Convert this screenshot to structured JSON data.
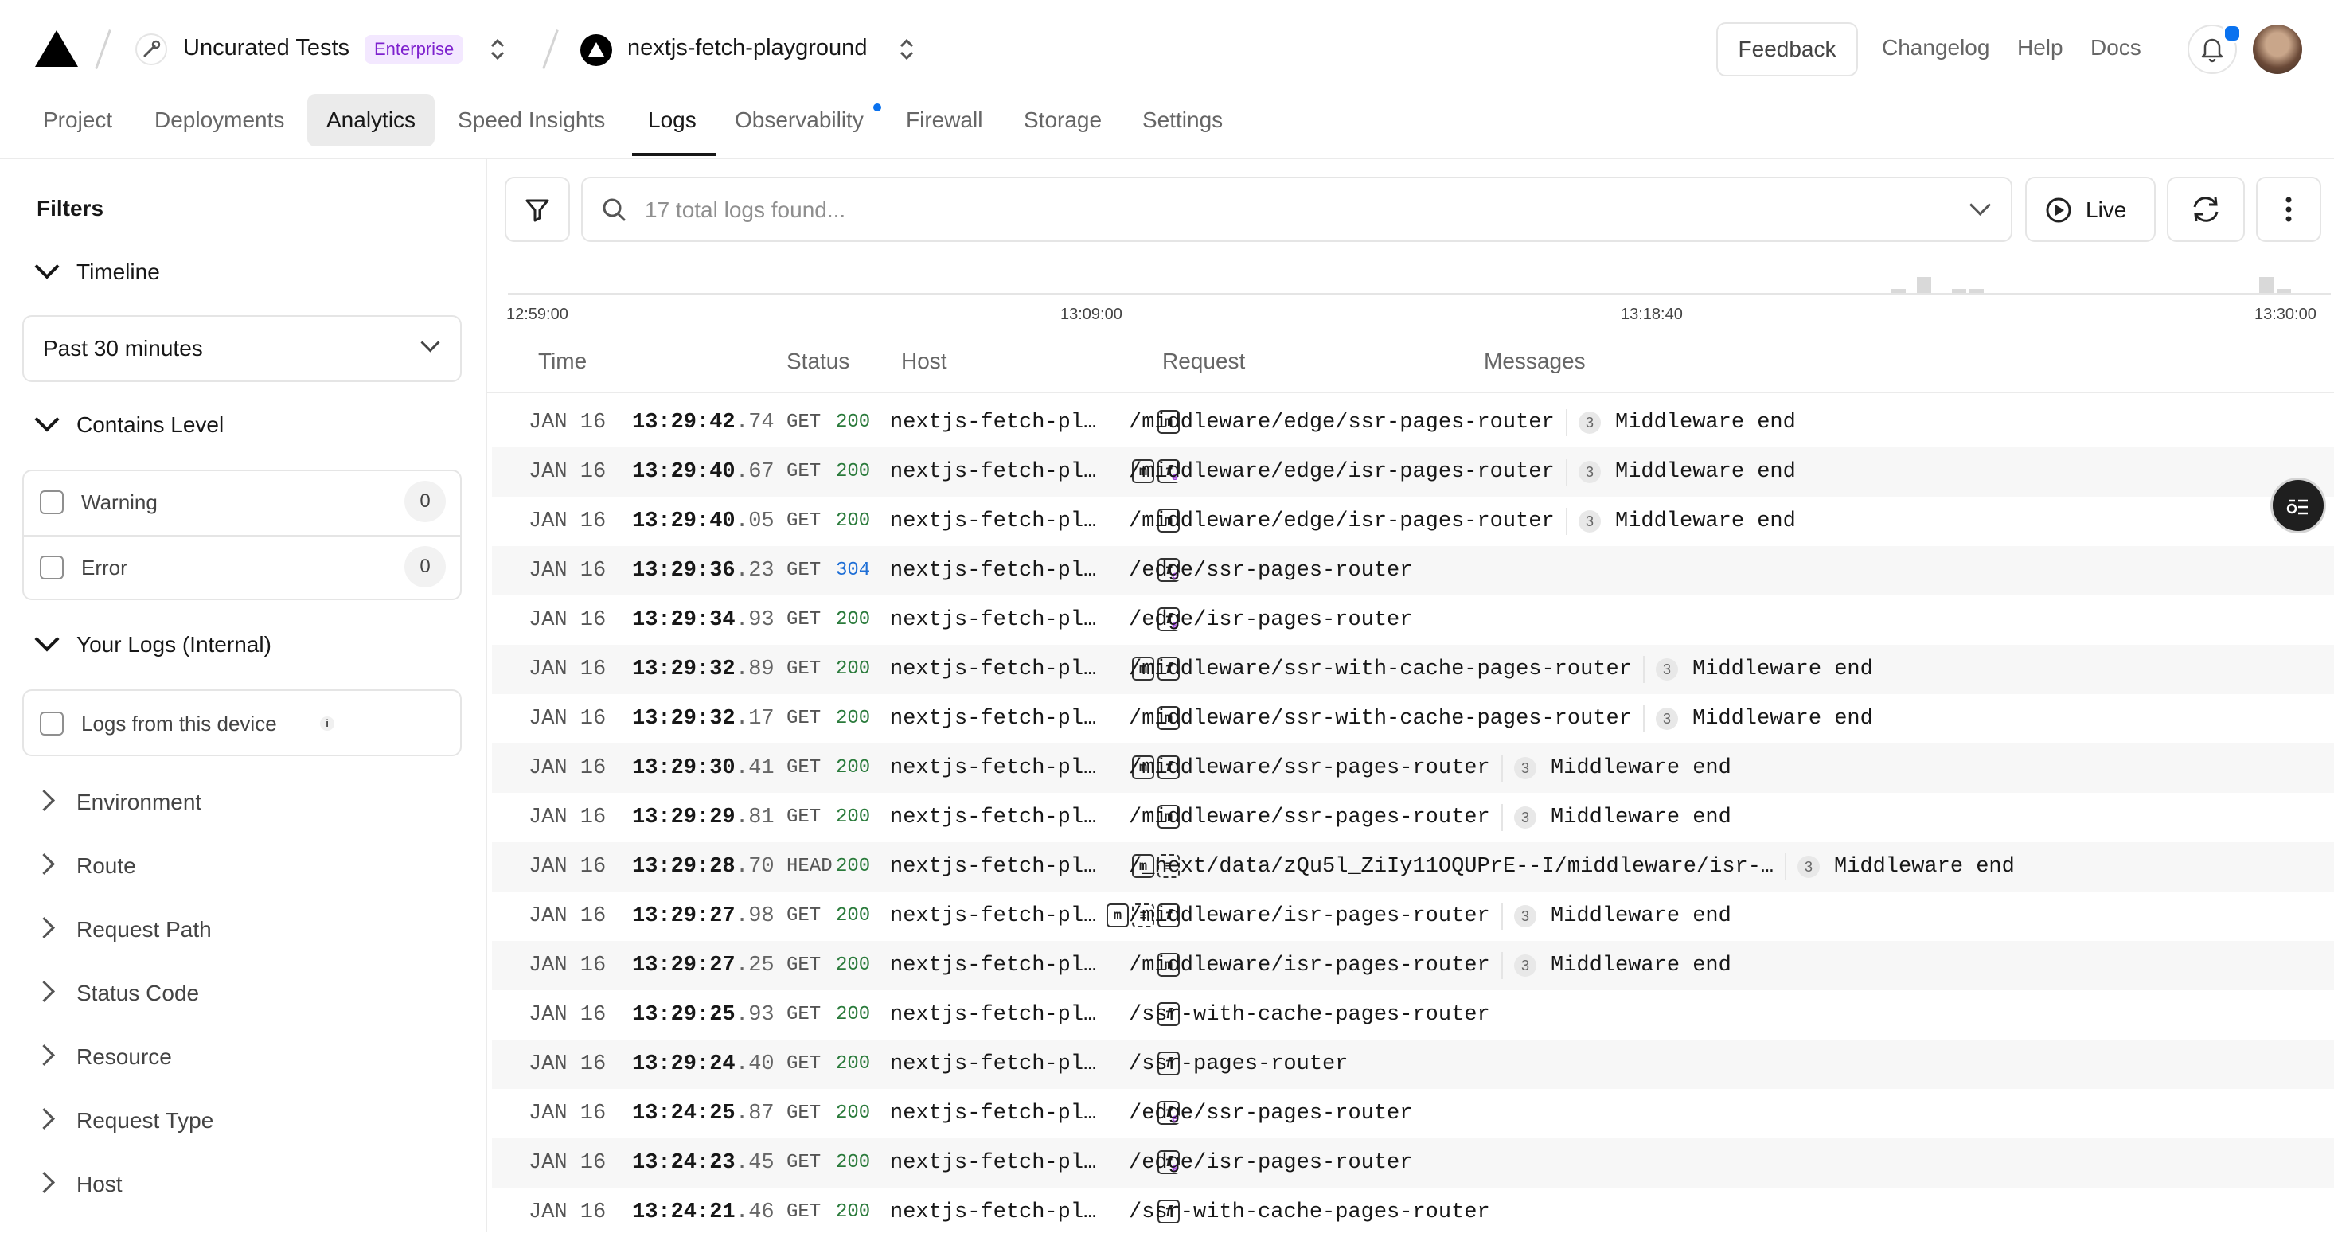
{
  "header": {
    "team_name": "Uncurated Tests",
    "plan_badge": "Enterprise",
    "project_name": "nextjs-fetch-playground",
    "feedback": "Feedback",
    "changelog": "Changelog",
    "help": "Help",
    "docs": "Docs"
  },
  "tabs": [
    "Project",
    "Deployments",
    "Analytics",
    "Speed Insights",
    "Logs",
    "Observability",
    "Firewall",
    "Storage",
    "Settings"
  ],
  "active_tab": "Logs",
  "sidebar": {
    "title": "Filters",
    "timeline": {
      "title": "Timeline",
      "selected": "Past 30 minutes"
    },
    "contains_level": {
      "title": "Contains Level",
      "options": [
        {
          "label": "Warning",
          "count": "0"
        },
        {
          "label": "Error",
          "count": "0"
        }
      ]
    },
    "your_logs": {
      "title": "Your Logs (Internal)",
      "option": "Logs from this device"
    },
    "collapsed_sections": [
      "Environment",
      "Route",
      "Request Path",
      "Status Code",
      "Resource",
      "Request Type",
      "Host"
    ]
  },
  "toolbar": {
    "search_placeholder": "17 total logs found...",
    "live": "Live"
  },
  "histogram": {
    "ticks": [
      "12:59:00",
      "13:09:00",
      "13:18:40",
      "13:30:00"
    ],
    "bars": [
      0.15,
      0.6,
      0.15,
      0.15,
      0.6,
      0.15
    ]
  },
  "columns": {
    "time": "Time",
    "status": "Status",
    "host": "Host",
    "request": "Request",
    "messages": "Messages"
  },
  "logs": [
    {
      "date": "JAN 16",
      "clock": "13:29:42",
      "frac": ".74",
      "method": "GET",
      "status": "200",
      "host": "nextjs-fetch-pl…",
      "icons": [
        "m"
      ],
      "path": "/middleware/edge/ssr-pages-router",
      "count": "3",
      "message": "Middleware end"
    },
    {
      "date": "JAN 16",
      "clock": "13:29:40",
      "frac": ".67",
      "method": "GET",
      "status": "200",
      "host": "nextjs-fetch-pl…",
      "icons": [
        "m",
        "fe"
      ],
      "path": "/middleware/edge/isr-pages-router",
      "count": "3",
      "message": "Middleware end"
    },
    {
      "date": "JAN 16",
      "clock": "13:29:40",
      "frac": ".05",
      "method": "GET",
      "status": "200",
      "host": "nextjs-fetch-pl…",
      "icons": [
        "m"
      ],
      "path": "/middleware/edge/isr-pages-router",
      "count": "3",
      "message": "Middleware end"
    },
    {
      "date": "JAN 16",
      "clock": "13:29:36",
      "frac": ".23",
      "method": "GET",
      "status": "304",
      "host": "nextjs-fetch-pl…",
      "icons": [
        "fe"
      ],
      "path": "/edge/ssr-pages-router",
      "count": "",
      "message": ""
    },
    {
      "date": "JAN 16",
      "clock": "13:29:34",
      "frac": ".93",
      "method": "GET",
      "status": "200",
      "host": "nextjs-fetch-pl…",
      "icons": [
        "fe"
      ],
      "path": "/edge/isr-pages-router",
      "count": "",
      "message": ""
    },
    {
      "date": "JAN 16",
      "clock": "13:29:32",
      "frac": ".89",
      "method": "GET",
      "status": "200",
      "host": "nextjs-fetch-pl…",
      "icons": [
        "m",
        "f"
      ],
      "path": "/middleware/ssr-with-cache-pages-router",
      "count": "3",
      "message": "Middleware end"
    },
    {
      "date": "JAN 16",
      "clock": "13:29:32",
      "frac": ".17",
      "method": "GET",
      "status": "200",
      "host": "nextjs-fetch-pl…",
      "icons": [
        "m"
      ],
      "path": "/middleware/ssr-with-cache-pages-router",
      "count": "3",
      "message": "Middleware end"
    },
    {
      "date": "JAN 16",
      "clock": "13:29:30",
      "frac": ".41",
      "method": "GET",
      "status": "200",
      "host": "nextjs-fetch-pl…",
      "icons": [
        "m",
        "f"
      ],
      "path": "/middleware/ssr-pages-router",
      "count": "3",
      "message": "Middleware end"
    },
    {
      "date": "JAN 16",
      "clock": "13:29:29",
      "frac": ".81",
      "method": "GET",
      "status": "200",
      "host": "nextjs-fetch-pl…",
      "icons": [
        "m"
      ],
      "path": "/middleware/ssr-pages-router",
      "count": "3",
      "message": "Middleware end"
    },
    {
      "date": "JAN 16",
      "clock": "13:29:28",
      "frac": ".70",
      "method": "HEAD",
      "status": "200",
      "host": "nextjs-fetch-pl…",
      "icons": [
        "m",
        "c"
      ],
      "path": "/_next/data/zQu5l_ZiIy11OQUPrE--I/middleware/isr-…",
      "count": "3",
      "message": "Middleware end"
    },
    {
      "date": "JAN 16",
      "clock": "13:29:27",
      "frac": ".98",
      "method": "GET",
      "status": "200",
      "host": "nextjs-fetch-pl…",
      "icons": [
        "m",
        "c",
        "f"
      ],
      "path": "/middleware/isr-pages-router",
      "count": "3",
      "message": "Middleware end"
    },
    {
      "date": "JAN 16",
      "clock": "13:29:27",
      "frac": ".25",
      "method": "GET",
      "status": "200",
      "host": "nextjs-fetch-pl…",
      "icons": [
        "m"
      ],
      "path": "/middleware/isr-pages-router",
      "count": "3",
      "message": "Middleware end"
    },
    {
      "date": "JAN 16",
      "clock": "13:29:25",
      "frac": ".93",
      "method": "GET",
      "status": "200",
      "host": "nextjs-fetch-pl…",
      "icons": [
        "f"
      ],
      "path": "/ssr-with-cache-pages-router",
      "count": "",
      "message": ""
    },
    {
      "date": "JAN 16",
      "clock": "13:29:24",
      "frac": ".40",
      "method": "GET",
      "status": "200",
      "host": "nextjs-fetch-pl…",
      "icons": [
        "f"
      ],
      "path": "/ssr-pages-router",
      "count": "",
      "message": ""
    },
    {
      "date": "JAN 16",
      "clock": "13:24:25",
      "frac": ".87",
      "method": "GET",
      "status": "200",
      "host": "nextjs-fetch-pl…",
      "icons": [
        "fe"
      ],
      "path": "/edge/ssr-pages-router",
      "count": "",
      "message": ""
    },
    {
      "date": "JAN 16",
      "clock": "13:24:23",
      "frac": ".45",
      "method": "GET",
      "status": "200",
      "host": "nextjs-fetch-pl…",
      "icons": [
        "fe"
      ],
      "path": "/edge/isr-pages-router",
      "count": "",
      "message": ""
    },
    {
      "date": "JAN 16",
      "clock": "13:24:21",
      "frac": ".46",
      "method": "GET",
      "status": "200",
      "host": "nextjs-fetch-pl…",
      "icons": [
        "f"
      ],
      "path": "/ssr-with-cache-pages-router",
      "count": "",
      "message": ""
    }
  ]
}
